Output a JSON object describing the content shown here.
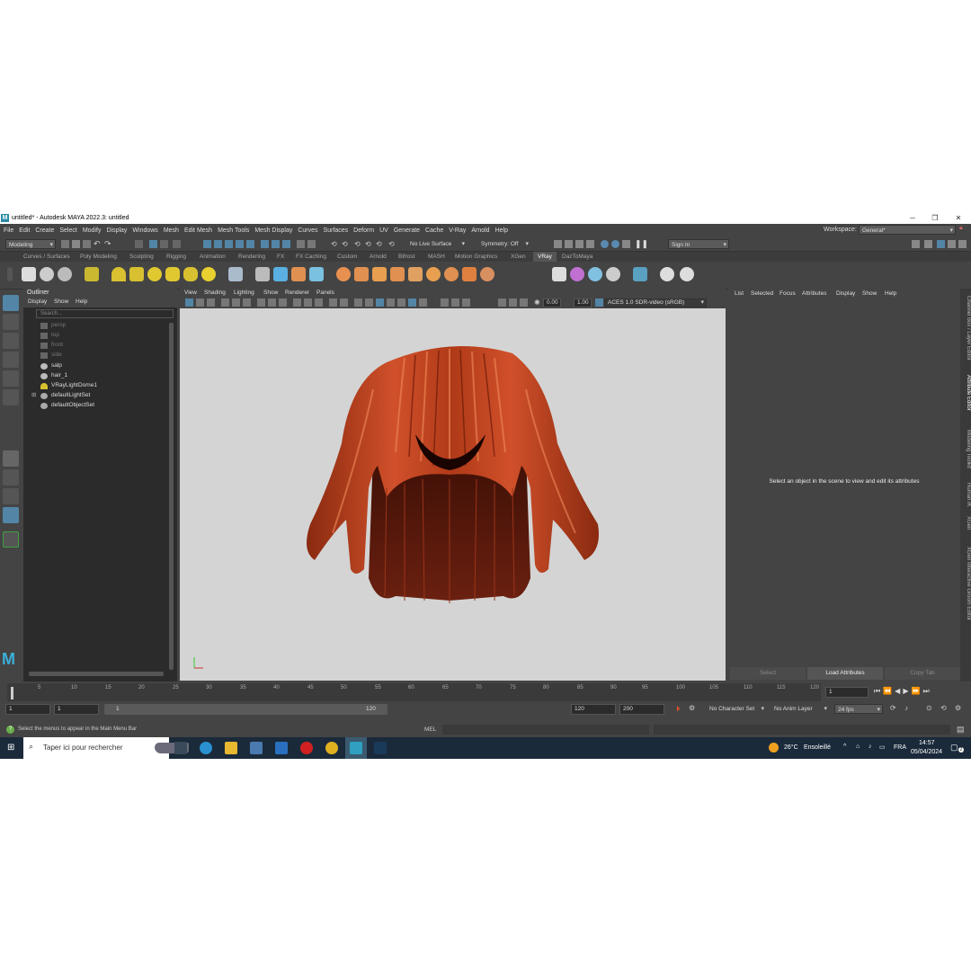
{
  "window": {
    "title": "untitled* - Autodesk MAYA 2022.3: untitled",
    "minimize": "─",
    "restore": "❐",
    "close": "✕"
  },
  "menubar": {
    "items": [
      "File",
      "Edit",
      "Create",
      "Select",
      "Modify",
      "Display",
      "Windows",
      "Mesh",
      "Edit Mesh",
      "Mesh Tools",
      "Mesh Display",
      "Curves",
      "Surfaces",
      "Deform",
      "UV",
      "Generate",
      "Cache",
      "V-Ray",
      "Arnold",
      "Help"
    ],
    "workspace_label": "Workspace:",
    "workspace_value": "General*"
  },
  "statusline": {
    "mode": "Modeling",
    "live_surface": "No Live Surface",
    "symmetry": "Symmetry: Off",
    "sign_in": "Sign In"
  },
  "shelf": {
    "tabs": [
      "Curves / Surfaces",
      "Poly Modeling",
      "Sculpting",
      "Rigging",
      "Animation",
      "Rendering",
      "FX",
      "FX Caching",
      "Custom",
      "Arnold",
      "Bifrost",
      "MASH",
      "Motion Graphics",
      "XGen",
      "VRay",
      "DazToMaya"
    ],
    "active_tab": "VRay"
  },
  "outliner": {
    "title": "Outliner",
    "menu": [
      "Display",
      "Show",
      "Help"
    ],
    "search_placeholder": "Search...",
    "items": [
      {
        "label": "persp",
        "dim": true,
        "icon": "camera-icon"
      },
      {
        "label": "top",
        "dim": true,
        "icon": "camera-icon"
      },
      {
        "label": "front",
        "dim": true,
        "icon": "camera-icon"
      },
      {
        "label": "side",
        "dim": true,
        "icon": "camera-icon"
      },
      {
        "label": "salp",
        "dim": false,
        "icon": "transform-icon"
      },
      {
        "label": "hair_1",
        "dim": false,
        "icon": "transform-icon"
      },
      {
        "label": "VRayLightDome1",
        "dim": false,
        "icon": "light-icon"
      },
      {
        "label": "defaultLightSet",
        "dim": false,
        "icon": "set-icon",
        "expandable": true
      },
      {
        "label": "defaultObjectSet",
        "dim": false,
        "icon": "set-icon"
      }
    ]
  },
  "viewport": {
    "menu": [
      "View",
      "Shading",
      "Lighting",
      "Show",
      "Renderer",
      "Panels"
    ],
    "exposure": "0.00",
    "gamma": "1.00",
    "colorspace": "ACES 1.0 SDR-video (sRGB)"
  },
  "attribute_editor": {
    "menu": [
      "List",
      "Selected",
      "Focus",
      "Attributes",
      "Display",
      "Show",
      "Help"
    ],
    "message": "Select an object in the scene to view and edit its attributes",
    "buttons": [
      "Select",
      "Load Attributes",
      "Copy Tab"
    ]
  },
  "side_tabs": [
    "Channel Box / Layer Editor",
    "Attribute Editor",
    "Modeling Toolkit",
    "Human IK",
    "XGen",
    "XGen Interactive Groom Editor"
  ],
  "timeslider": {
    "ticks": [
      "5",
      "10",
      "15",
      "20",
      "25",
      "30",
      "35",
      "40",
      "45",
      "50",
      "55",
      "60",
      "65",
      "70",
      "75",
      "80",
      "85",
      "90",
      "95",
      "100",
      "105",
      "110",
      "115",
      "120"
    ],
    "current_frame": "1"
  },
  "range": {
    "start": "1",
    "playback_start": "1",
    "range_start_label": "1",
    "range_end_label": "120",
    "playback_end": "120",
    "end": "200",
    "character_set": "No Character Set",
    "anim_layer": "No Anim Layer",
    "fps": "24 fps"
  },
  "commandline": {
    "help_text": "Select the menus to appear in the Main Menu Bar",
    "language": "MEL"
  },
  "taskbar": {
    "search_placeholder": "Taper ici pour rechercher",
    "weather_temp": "26°C",
    "weather_desc": "Ensoleillé",
    "language": "FRA",
    "time": "14:57",
    "date": "05/04/2024",
    "notification_count": "2"
  },
  "colors": {
    "accent": "#5285a6",
    "hair": "#c0401a",
    "viewport_bg": "#d4d4d4",
    "panel": "#444444"
  }
}
